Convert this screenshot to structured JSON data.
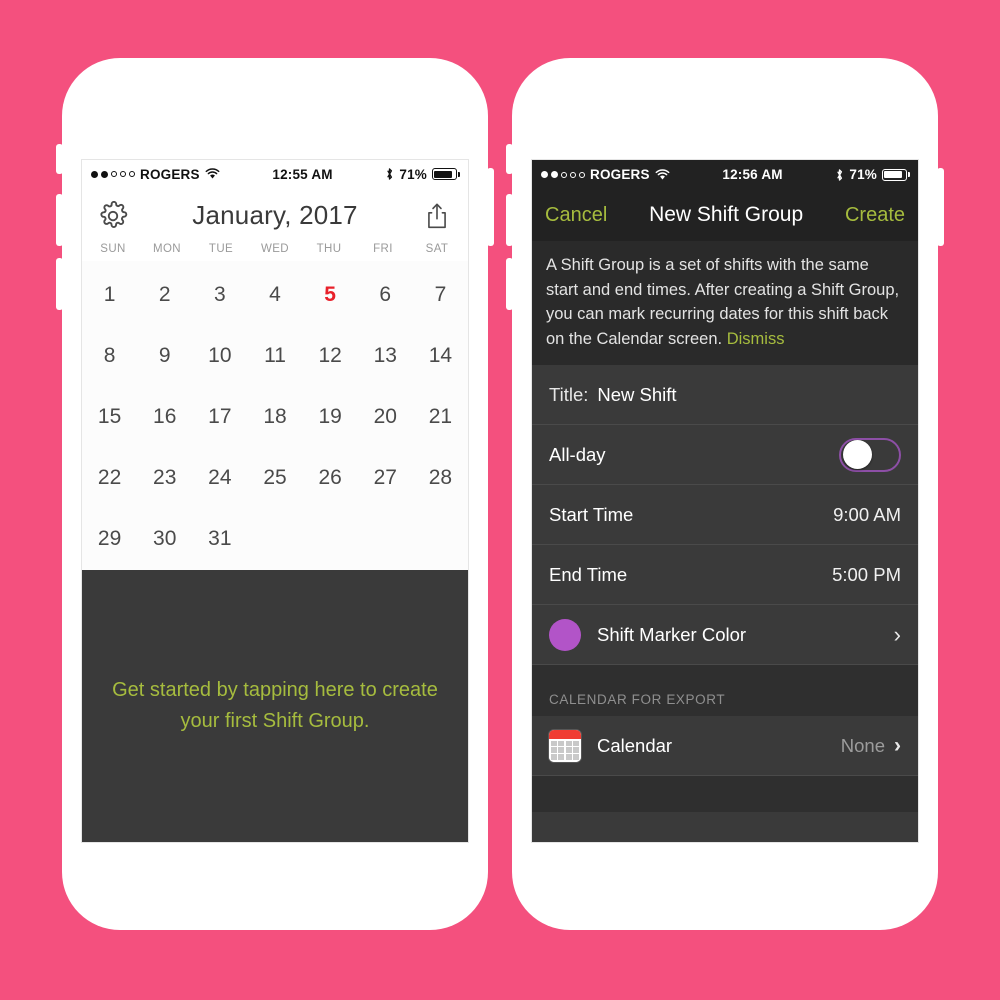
{
  "theme": {
    "background_pink": "#f4507e",
    "accent_green": "#a6bc3e",
    "accent_purple": "#b254c8",
    "toggle_border_purple": "#8d4fa6",
    "today_red": "#e8202a",
    "dark_panel": "#3a3a3a",
    "navbar_dark": "#222222"
  },
  "left_phone": {
    "status_bar": {
      "carrier": "ROGERS",
      "time": "12:55 AM",
      "battery_percent": "71%",
      "signal_filled_dots": 2,
      "signal_total_dots": 5,
      "wifi_icon": "wifi-icon",
      "bluetooth_icon": "bluetooth-icon",
      "battery_icon": "battery-icon"
    },
    "header": {
      "settings_icon": "gear-icon",
      "title": "January, 2017",
      "share_icon": "share-icon"
    },
    "weekdays": [
      "SUN",
      "MON",
      "TUE",
      "WED",
      "THU",
      "FRI",
      "SAT"
    ],
    "days": [
      "1",
      "2",
      "3",
      "4",
      "5",
      "6",
      "7",
      "8",
      "9",
      "10",
      "11",
      "12",
      "13",
      "14",
      "15",
      "16",
      "17",
      "18",
      "19",
      "20",
      "21",
      "22",
      "23",
      "24",
      "25",
      "26",
      "27",
      "28",
      "29",
      "30",
      "31"
    ],
    "today": "5",
    "promo_text": "Get started by tapping here to create your first Shift Group."
  },
  "right_phone": {
    "status_bar": {
      "carrier": "ROGERS",
      "time": "12:56 AM",
      "battery_percent": "71%",
      "signal_filled_dots": 2,
      "signal_total_dots": 5,
      "wifi_icon": "wifi-icon",
      "bluetooth_icon": "bluetooth-icon",
      "battery_icon": "battery-icon"
    },
    "navbar": {
      "cancel_label": "Cancel",
      "title": "New Shift Group",
      "create_label": "Create"
    },
    "info": {
      "body": "A Shift Group is a set of shifts with the same start and end times. After creating a Shift Group, you can mark recurring dates for this shift back on the Calendar screen. ",
      "dismiss_label": "Dismiss"
    },
    "form": {
      "title_key": "Title:",
      "title_value": "New Shift",
      "all_day_label": "All-day",
      "all_day_on": false,
      "start_time_label": "Start Time",
      "start_time_value": "9:00 AM",
      "end_time_label": "End Time",
      "end_time_value": "5:00 PM",
      "marker_color_label": "Shift Marker Color",
      "marker_color_swatch": "#b254c8",
      "chevron_icon": "chevron-right-icon"
    },
    "export_section": {
      "header": "CALENDAR FOR EXPORT",
      "calendar_icon": "calendar-icon",
      "calendar_label": "Calendar",
      "calendar_value": "None",
      "chevron_icon": "chevron-right-icon"
    }
  }
}
